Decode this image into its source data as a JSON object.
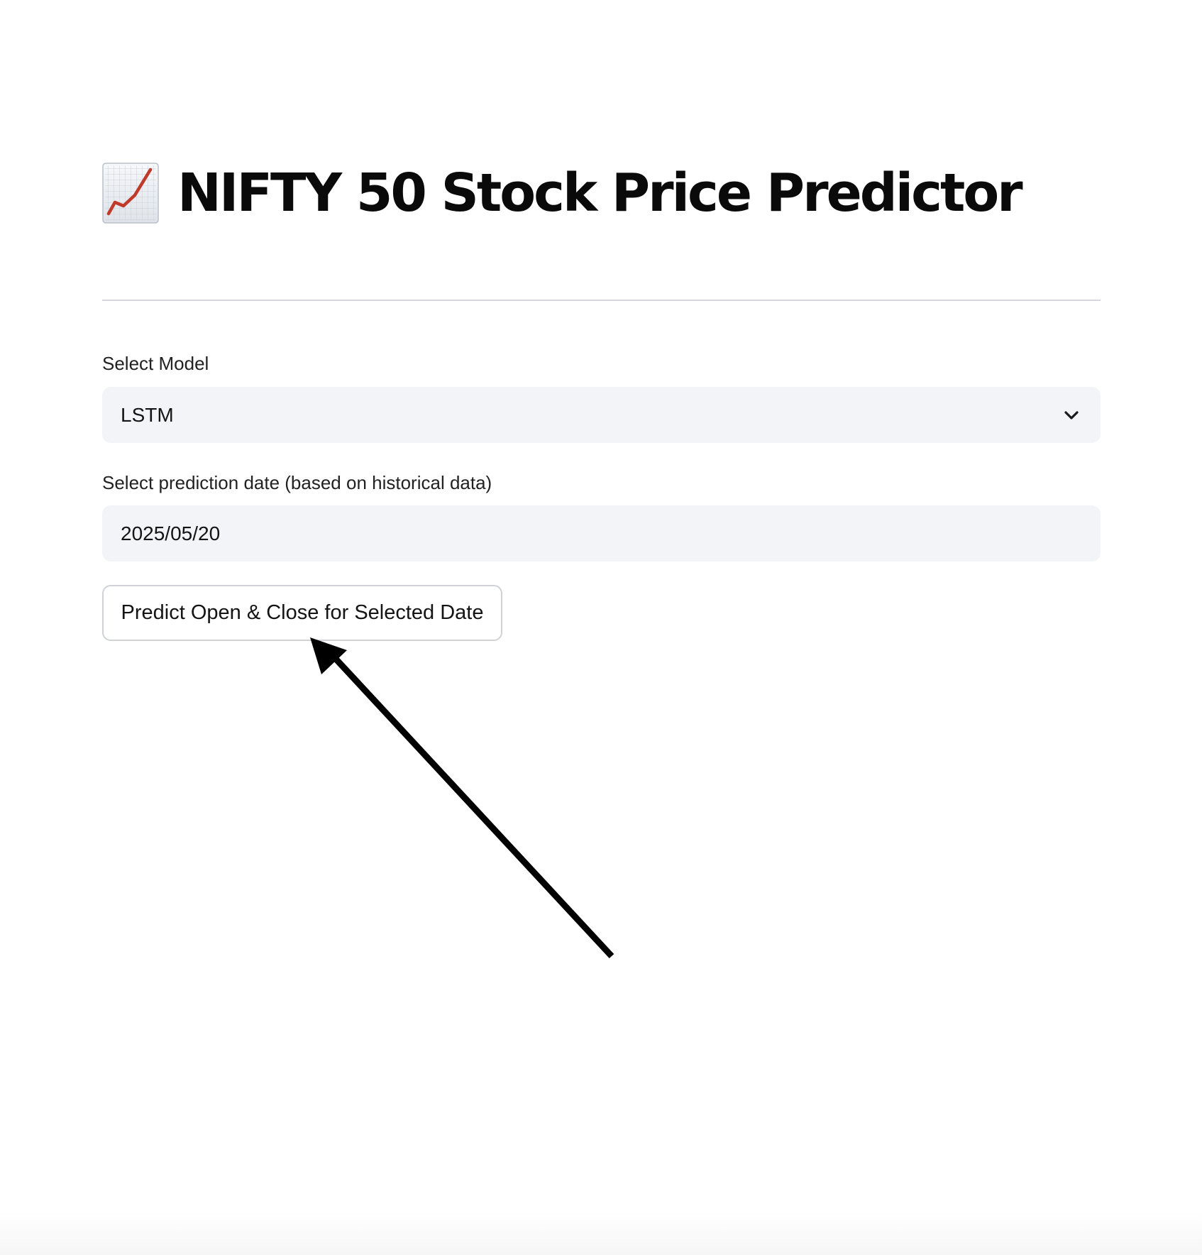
{
  "header": {
    "title": "NIFTY 50 Stock Price Predictor",
    "icon": "chart-increasing-icon"
  },
  "model_field": {
    "label": "Select Model",
    "value": "LSTM",
    "icon": "chevron-down-icon"
  },
  "date_field": {
    "label": "Select prediction date (based on historical data)",
    "value": "2025/05/20"
  },
  "predict_button": {
    "label": "Predict Open & Close for Selected Date"
  },
  "annotation": {
    "icon": "arrow-pointer",
    "color": "#000000"
  },
  "colors": {
    "input_background": "#f3f4f8",
    "divider": "#d6d7dc",
    "trend_line": "#c0392b"
  }
}
